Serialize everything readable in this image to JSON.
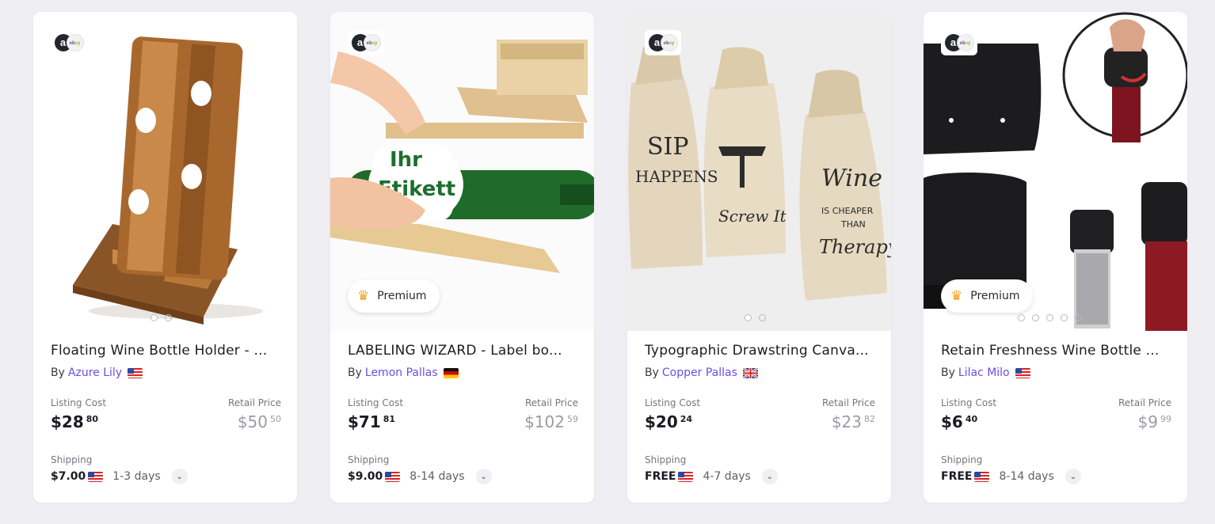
{
  "labels": {
    "by": "By",
    "listing_cost": "Listing Cost",
    "retail_price": "Retail Price",
    "shipping": "Shipping",
    "premium": "Premium"
  },
  "source_logo": {
    "amazon_letter": "a",
    "ebay_letters": [
      "e",
      "b",
      "a",
      "y"
    ]
  },
  "cards": [
    {
      "title": "Floating Wine Bottle Holder - ...",
      "seller": "Azure Lily",
      "seller_flag": "us",
      "listing_cost": {
        "whole": "$28",
        "cents": "80"
      },
      "retail_price": {
        "whole": "$50",
        "cents": "50"
      },
      "shipping_cost": "$7.00",
      "shipping_flag": "us",
      "shipping_days": "1-3 days",
      "premium": false,
      "image_icon": "wooden-wine-rack-image",
      "carousel_dots": 2
    },
    {
      "title": "LABELING WIZARD - Label bo...",
      "seller": "Lemon Pallas",
      "seller_flag": "de",
      "listing_cost": {
        "whole": "$71",
        "cents": "81"
      },
      "retail_price": {
        "whole": "$102",
        "cents": "59"
      },
      "shipping_cost": "$9.00",
      "shipping_flag": "us",
      "shipping_days": "8-14 days",
      "premium": true,
      "image_icon": "label-applicator-image",
      "image_text": [
        "Ihr",
        "Etikett"
      ],
      "carousel_dots": 0
    },
    {
      "title": "Typographic Drawstring Canva...",
      "seller": "Copper Pallas",
      "seller_flag": "gb",
      "listing_cost": {
        "whole": "$20",
        "cents": "24"
      },
      "retail_price": {
        "whole": "$23",
        "cents": "82"
      },
      "shipping_cost": "FREE",
      "shipping_flag": "us",
      "shipping_days": "4-7 days",
      "premium": false,
      "image_icon": "canvas-wine-bags-image",
      "image_text": [
        "SIP",
        "HAPPENS",
        "Screw It",
        "Wine",
        "IS CHEAPER",
        "THAN",
        "Therapy"
      ],
      "carousel_dots": 2
    },
    {
      "title": "Retain Freshness Wine Bottle ...",
      "seller": "Lilac Milo",
      "seller_flag": "us",
      "listing_cost": {
        "whole": "$6",
        "cents": "40"
      },
      "retail_price": {
        "whole": "$9",
        "cents": "99"
      },
      "shipping_cost": "FREE",
      "shipping_flag": "us",
      "shipping_days": "8-14 days",
      "premium": true,
      "image_icon": "wine-stopper-image",
      "carousel_dots": 5
    }
  ],
  "colors": {
    "seller_link": "#6b4de6",
    "premium_crown": "#f0a020",
    "background": "#eeeef3"
  }
}
